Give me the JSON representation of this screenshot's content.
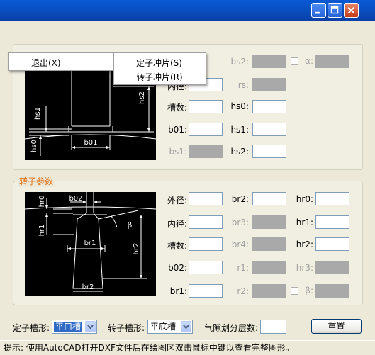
{
  "menu_bar": {
    "exit": "退出(X)"
  },
  "popup_menu": {
    "items": [
      "定子冲片(S)",
      "转子冲片(R)"
    ]
  },
  "stator": {
    "fields": {
      "bs2": "bs2:",
      "alpha": "α:",
      "inner_diameter": "内径:",
      "rs": "rs:",
      "slots": "槽数:",
      "hs0": "hs0:",
      "b01": "b01:",
      "hs1": "hs1:",
      "bs1": "bs1:",
      "hs2": "hs2:"
    },
    "diagram_labels": {
      "hs1": "hs1",
      "hs0": "hs0",
      "hs2": "hs2",
      "b01": "b01"
    }
  },
  "rotor": {
    "title": "转子参数",
    "fields": {
      "outer_diameter": "外径:",
      "br2": "br2:",
      "hr0": "hr0:",
      "inner_diameter": "内径:",
      "br3": "br3:",
      "hr1": "hr1:",
      "slots": "槽数:",
      "br4": "br4:",
      "hr2": "hr2:",
      "b02": "b02:",
      "r1": "r1:",
      "hr3": "hr3:",
      "br1": "br1:",
      "r2": "r2:",
      "beta": "β:"
    },
    "diagram_labels": {
      "hr0": "hr0",
      "b02": "b02",
      "beta": "β",
      "hr1": "hr1",
      "br1": "br1",
      "hr2": "hr2",
      "br2": "br2"
    }
  },
  "bottom": {
    "stator_slot_label": "定子槽形:",
    "stator_slot_value": "平口槽",
    "rotor_slot_label": "转子槽形:",
    "rotor_slot_value": "平底槽",
    "air_gap_label": "气隙划分层数:",
    "reset_label": "重置"
  },
  "status_bar": {
    "text": "提示: 使用AutoCAD打开DXF文件后在绘图区双击鼠标中键以查看完整图形。"
  },
  "colors": {
    "title_bar": "#0a5ad4",
    "group_title": "#e07016",
    "disabled_field": "#a9a9a9",
    "selection": "#316ac5"
  }
}
